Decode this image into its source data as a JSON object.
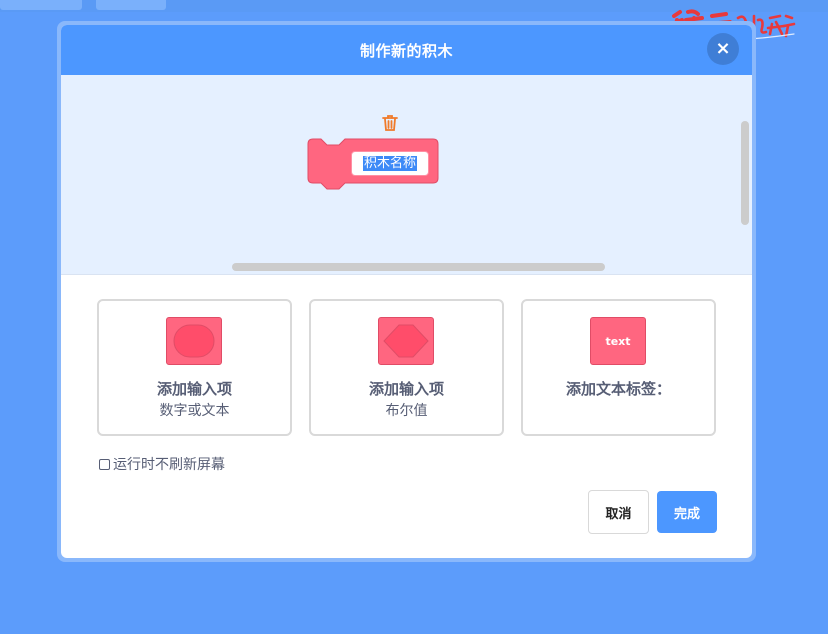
{
  "brand": {
    "logo_text": "逆云少儿编程",
    "icon": "brand-logo"
  },
  "dialog": {
    "title": "制作新的积木",
    "close_label": "×",
    "close_icon": "close-icon"
  },
  "workspace": {
    "trash_icon": "trash-icon",
    "block_name_value": "积木名称",
    "block_color": "#ff6680"
  },
  "options": [
    {
      "title": "添加输入项",
      "subtitle": "数字或文本",
      "icon": "round-input-icon"
    },
    {
      "title": "添加输入项",
      "subtitle": "布尔值",
      "icon": "boolean-input-icon"
    },
    {
      "title": "添加文本标签：",
      "subtitle": "",
      "icon_text": "text",
      "icon": "text-label-icon"
    }
  ],
  "refresh": {
    "label": "运行时不刷新屏幕",
    "checked": false
  },
  "buttons": {
    "cancel_label": "取消",
    "ok_label": "完成"
  },
  "colors": {
    "accent": "#4c97ff",
    "background": "#5c9cfb",
    "block_pink": "#ff6680",
    "trash_orange": "#f07a2a",
    "text": "#575e75"
  }
}
